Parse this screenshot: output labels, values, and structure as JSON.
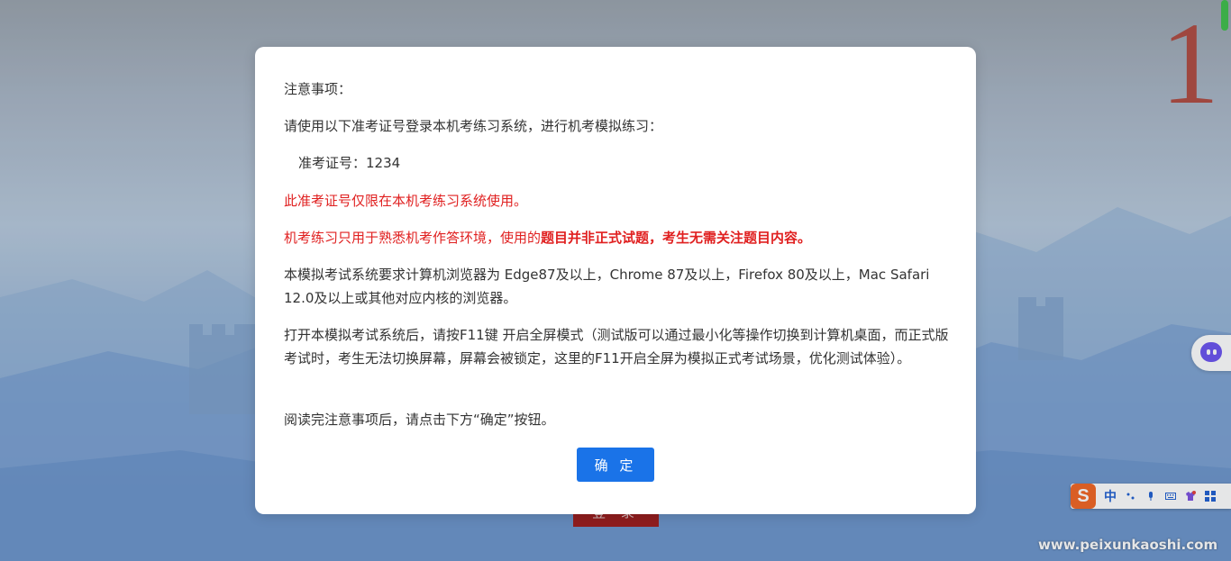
{
  "background": {
    "page_number": "1",
    "login_button_label": "登 录",
    "watermark": "www.peixunkaoshi.com"
  },
  "dialog": {
    "title": "注意事项：",
    "intro": "请使用以下准考证号登录本机考练习系统，进行机考模拟练习：",
    "ticket_label": "准考证号：",
    "ticket_number": "1234",
    "red_notice_1": "此准考证号仅限在本机考练习系统使用。",
    "red_notice_2_prefix": "机考练习只用于熟悉机考作答环境，使用的",
    "red_notice_2_bold": "题目并非正式试题，考生无需关注题目内容。",
    "browser_requirement": "本模拟考试系统要求计算机浏览器为 Edge87及以上，Chrome 87及以上，Firefox 80及以上，Mac Safari 12.0及以上或其他对应内核的浏览器。",
    "f11_notice": "打开本模拟考试系统后，请按F11键 开启全屏模式（测试版可以通过最小化等操作切换到计算机桌面，而正式版考试时，考生无法切换屏幕，屏幕会被锁定，这里的F11开启全屏为模拟正式考试场景，优化测试体验）。",
    "read_notice": "阅读完注意事项后，请点击下方“确定”按钮。",
    "confirm_label": "确 定"
  },
  "ime_toolbar": {
    "logo": "S",
    "mode": "中",
    "icons": [
      "punctuation-icon",
      "microphone-icon",
      "keyboard-icon",
      "skin-icon",
      "toolbox-icon"
    ]
  },
  "colors": {
    "primary": "#1a73e8",
    "warning_red": "#e02020",
    "page_number": "#b04a40",
    "login_button": "#9e1b1b"
  }
}
